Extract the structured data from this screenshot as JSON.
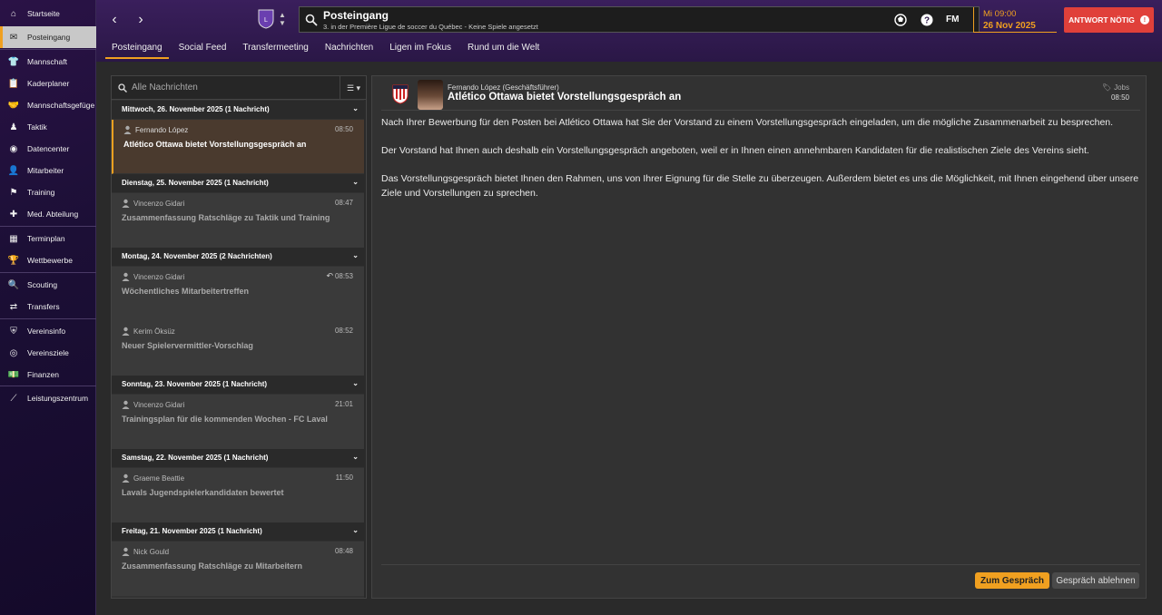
{
  "sidebar": {
    "items": [
      {
        "label": "Startseite",
        "icon": "home-icon"
      },
      {
        "label": "Posteingang",
        "icon": "inbox-icon",
        "active": true
      },
      {
        "label": "Mannschaft",
        "icon": "shirt-icon"
      },
      {
        "label": "Kaderplaner",
        "icon": "clipboard-icon"
      },
      {
        "label": "Mannschaftsgefüge",
        "icon": "handshake-icon"
      },
      {
        "label": "Taktik",
        "icon": "tactics-icon"
      },
      {
        "label": "Datencenter",
        "icon": "data-icon"
      },
      {
        "label": "Mitarbeiter",
        "icon": "staff-icon"
      },
      {
        "label": "Training",
        "icon": "training-icon"
      },
      {
        "label": "Med. Abteilung",
        "icon": "medical-icon"
      },
      {
        "label": "Terminplan",
        "icon": "calendar-icon"
      },
      {
        "label": "Wettbewerbe",
        "icon": "trophy-icon"
      },
      {
        "label": "Scouting",
        "icon": "magnifier-icon"
      },
      {
        "label": "Transfers",
        "icon": "transfer-icon"
      },
      {
        "label": "Vereinsinfo",
        "icon": "shield-icon"
      },
      {
        "label": "Vereinsziele",
        "icon": "goals-icon"
      },
      {
        "label": "Finanzen",
        "icon": "money-icon"
      },
      {
        "label": "Leistungszentrum",
        "icon": "performance-icon"
      }
    ]
  },
  "header": {
    "title": "Posteingang",
    "subtitle": "3. in der Première Ligue de soccer du Québec - Keine Spiele angesetzt",
    "time": "Mi 09:00",
    "date": "26 Nov 2025",
    "reply_label": "ANTWORT NÖTIG",
    "fm_label": "FM"
  },
  "tabs": [
    "Posteingang",
    "Social Feed",
    "Transfermeeting",
    "Nachrichten",
    "Ligen im Fokus",
    "Rund um die Welt"
  ],
  "list": {
    "filter_placeholder": "Alle Nachrichten",
    "groups": [
      {
        "heading": "Mittwoch, 26. November 2025 (1 Nachricht)",
        "messages": [
          {
            "sender": "Fernando López",
            "time": "08:50",
            "subject": "Atlético Ottawa bietet Vorstellungsgespräch an",
            "selected": true
          }
        ]
      },
      {
        "heading": "Dienstag, 25. November 2025 (1 Nachricht)",
        "messages": [
          {
            "sender": "Vincenzo Gidari",
            "time": "08:47",
            "subject": "Zusammenfassung Ratschläge zu Taktik und Training"
          }
        ]
      },
      {
        "heading": "Montag, 24. November 2025 (2 Nachrichten)",
        "messages": [
          {
            "sender": "Vincenzo Gidari",
            "time": "08:53",
            "subject": "Wöchentliches Mitarbeitertreffen",
            "replied": true
          },
          {
            "sender": "Kerim Öksüz",
            "time": "08:52",
            "subject": "Neuer Spielervermittler-Vorschlag"
          }
        ]
      },
      {
        "heading": "Sonntag, 23. November 2025 (1 Nachricht)",
        "messages": [
          {
            "sender": "Vincenzo Gidari",
            "time": "21:01",
            "subject": "Trainingsplan für die kommenden Wochen - FC Laval"
          }
        ]
      },
      {
        "heading": "Samstag, 22. November 2025 (1 Nachricht)",
        "messages": [
          {
            "sender": "Graeme Beattie",
            "time": "11:50",
            "subject": "Lavals Jugendspielerkandidaten bewertet"
          }
        ]
      },
      {
        "heading": "Freitag, 21. November 2025 (1 Nachricht)",
        "messages": [
          {
            "sender": "Nick Gould",
            "time": "08:48",
            "subject": "Zusammenfassung Ratschläge zu Mitarbeitern"
          }
        ]
      }
    ]
  },
  "message": {
    "from": "Fernando López  (Geschäftsführer)",
    "subject": "Atlético Ottawa bietet Vorstellungsgespräch an",
    "category": "Jobs",
    "time": "08:50",
    "body": [
      "Nach Ihrer Bewerbung für den Posten bei Atlético Ottawa hat Sie der Vorstand zu einem Vorstellungsgespräch eingeladen, um die mögliche Zusammenarbeit zu besprechen.",
      "Der Vorstand hat Ihnen auch deshalb ein Vorstellungsgespräch angeboten, weil er in Ihnen einen annehmbaren Kandidaten für die realistischen Ziele des Vereins sieht.",
      "Das Vorstellungsgespräch bietet Ihnen den Rahmen, uns von Ihrer Eignung für die Stelle zu überzeugen. Außerdem bietet es uns die Möglichkeit, mit Ihnen eingehend über unsere Ziele und Vorstellungen zu sprechen."
    ],
    "accept_label": "Zum Gespräch",
    "decline_label": "Gespräch ablehnen"
  },
  "colors": {
    "accent": "#f0a020",
    "alert": "#e0403a",
    "sidebar": "#1c0f36"
  }
}
